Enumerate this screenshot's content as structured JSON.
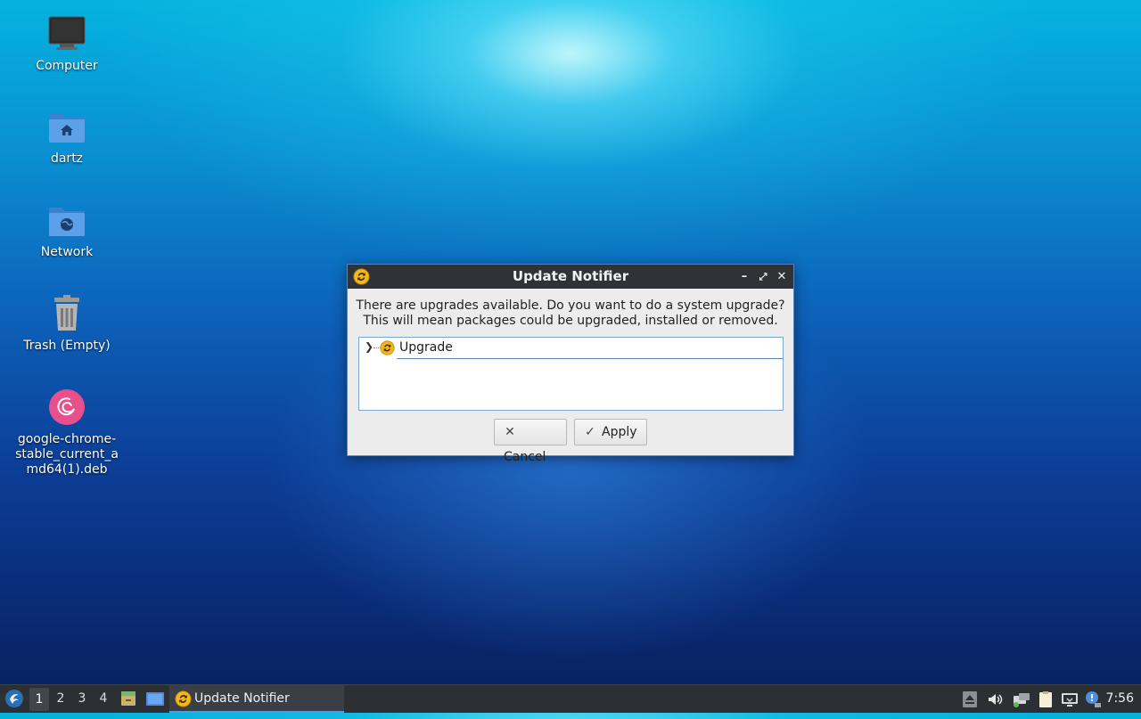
{
  "desktop": {
    "icons": [
      {
        "label": "Computer"
      },
      {
        "label": "dartz"
      },
      {
        "label": "Network"
      },
      {
        "label": "Trash (Empty)"
      },
      {
        "label": "google-chrome-\nstable_current_a\nmd64(1).deb"
      }
    ]
  },
  "dialog": {
    "title": "Update Notifier",
    "message_line1": "There are upgrades available. Do you want to do a system upgrade?",
    "message_line2": "This will mean packages could be upgraded, installed or removed.",
    "tree_items": [
      {
        "label": "Upgrade",
        "expanded": false
      }
    ],
    "cancel_label": "Cancel",
    "apply_label": "Apply",
    "window_controls": [
      "minimize-icon",
      "maximize-icon",
      "close-icon"
    ]
  },
  "taskbar": {
    "workspaces": [
      "1",
      "2",
      "3",
      "4"
    ],
    "active_workspace": "1",
    "task_label": "Update Notifier",
    "clock": "7:56",
    "tray_icons": [
      "eject-icon",
      "volume-icon",
      "network-icon",
      "clipboard-icon",
      "display-icon",
      "notification-icon"
    ]
  },
  "colors": {
    "titlebar": "#2f3338",
    "taskbar": "#2c3034",
    "accent": "#5a84b8",
    "update_icon": "#f2b81b"
  }
}
